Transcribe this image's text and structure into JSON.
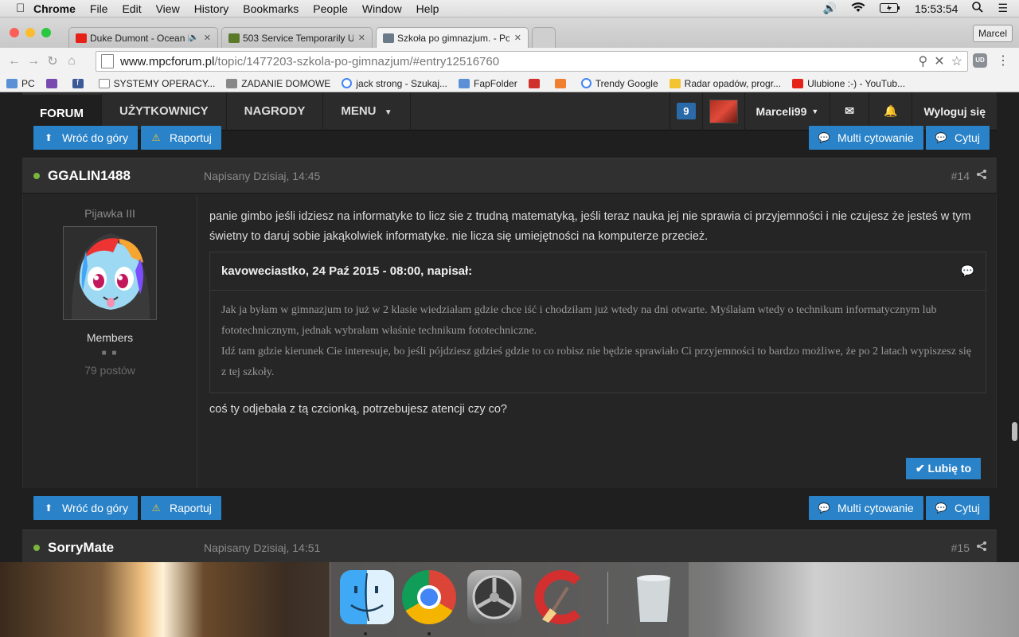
{
  "menubar": {
    "app": "Chrome",
    "items": [
      "File",
      "Edit",
      "View",
      "History",
      "Bookmarks",
      "People",
      "Window",
      "Help"
    ],
    "time": "15:53:54"
  },
  "tabs": [
    {
      "title": "Duke Dumont - Ocean D",
      "favicon_color": "#e62117"
    },
    {
      "title": "503 Service Temporarily U",
      "favicon_color": "#5a7a2a"
    },
    {
      "title": "Szkoła po gimnazjum. - Po",
      "favicon_color": "#6a7a88"
    }
  ],
  "profile_name": "Marcel",
  "address": {
    "host": "www.mpcforum.pl",
    "path": "/topic/1477203-szkola-po-gimnazjum/#entry12516760"
  },
  "bookmarks": [
    {
      "label": "PC",
      "color": "#5b8fd6"
    },
    {
      "label": "",
      "color": "#7a4ab0"
    },
    {
      "label": "",
      "color": "#3b5998"
    },
    {
      "label": "SYSTEMY OPERACY...",
      "color": "#ffffff"
    },
    {
      "label": "ZADANIE DOMOWE",
      "color": "#888888"
    },
    {
      "label": "jack strong - Szukaj...",
      "color": "#4285f4"
    },
    {
      "label": "FapFolder",
      "color": "#5b8fd6"
    },
    {
      "label": "",
      "color": "#d0312d"
    },
    {
      "label": "",
      "color": "#f08030"
    },
    {
      "label": "Trendy Google",
      "color": "#4285f4"
    },
    {
      "label": "Radar opadów, progr...",
      "color": "#f4c430"
    },
    {
      "label": "Ulubione :-) - YouTub...",
      "color": "#e62117"
    }
  ],
  "forum_nav": {
    "items": [
      "FORUM",
      "UŻYTKOWNICY",
      "NAGRODY",
      "MENU"
    ],
    "notif_count": "9",
    "username": "Marceli99",
    "logout": "Wyloguj się"
  },
  "buttons": {
    "back_to_top": "Wróć do góry",
    "report": "Raportuj",
    "multiquote": "Multi cytowanie",
    "quote": "Cytuj",
    "like": "✔ Lubię to"
  },
  "post": {
    "author": "GGALIN1488",
    "date": "Napisany Dzisiaj, 14:45",
    "number": "#14",
    "rank": "Pijawka III",
    "group": "Members",
    "posts": "79 postów",
    "text": "panie gimbo jeśli idziesz na informatyke to licz sie z trudną matematyką, jeśli teraz nauka jej nie sprawia ci przyjemności i nie czujesz że jesteś w tym świetny to daruj sobie jakąkolwiek informatyke. nie licza się umiejętności na komputerze przecież.",
    "quote_header": "kavoweciastko, 24 Paź 2015 - 08:00, napisał:",
    "quote_p1": "Jak ja byłam w gimnazjum to już w 2 klasie wiedziałam gdzie chce iść i chodziłam już wtedy na dni otwarte. Myślałam wtedy o technikum informatycznym lub fototechnicznym, jednak wybrałam właśnie technikum fototechniczne.",
    "quote_p2": "Idź tam gdzie kierunek Cie interesuje, bo jeśli pójdziesz gdzieś gdzie to co robisz nie będzie sprawiało Ci przyjemności to bardzo możliwe, że po 2 latach wypiszesz się z tej szkoły.",
    "reply": "coś ty odjebała z tą czcionką, potrzebujesz atencji czy co?"
  },
  "next_post": {
    "author": "SorryMate",
    "date": "Napisany Dzisiaj, 14:51",
    "number": "#15"
  },
  "dock": [
    "finder-icon",
    "chrome-icon",
    "system-preferences-icon",
    "ccleaner-icon",
    "trash-icon"
  ]
}
